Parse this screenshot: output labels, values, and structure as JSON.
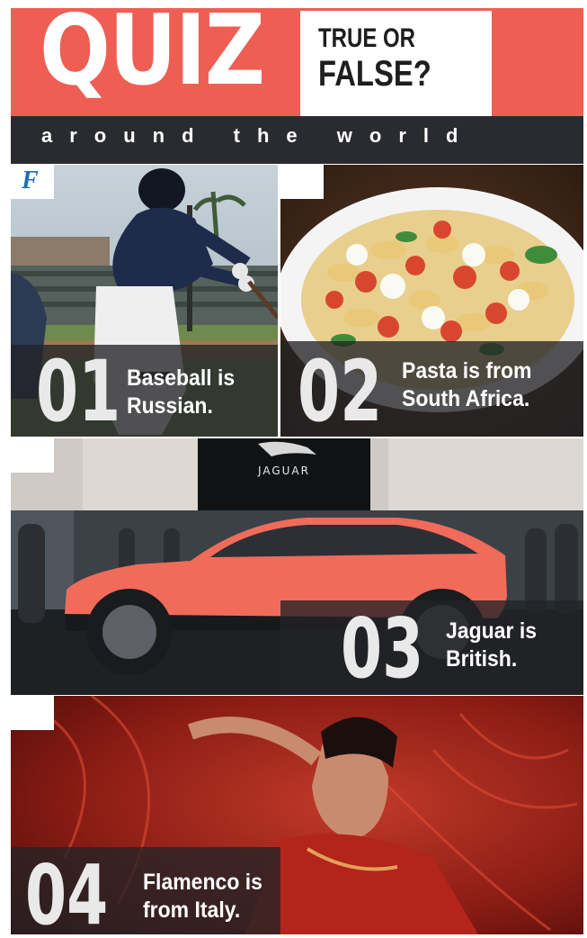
{
  "header": {
    "title": "QUIZ",
    "tf_line1": "TRUE OR",
    "tf_line2": "FALSE?",
    "subtitle": "around the world"
  },
  "quiz": [
    {
      "number": "01",
      "answer": "F",
      "statement_line1": "Baseball is",
      "statement_line2": "Russian."
    },
    {
      "number": "02",
      "answer": "",
      "statement_line1": "Pasta is from",
      "statement_line2": "South Africa."
    },
    {
      "number": "03",
      "answer": "",
      "statement_line1": "Jaguar is",
      "statement_line2": "British."
    },
    {
      "number": "04",
      "answer": "",
      "statement_line1": "Flamenco is",
      "statement_line2": "from Italy."
    }
  ],
  "brand_sign": "JAGUAR",
  "colors": {
    "accent": "#ef5e53",
    "dark_band": "#2a2b30",
    "answer_mark": "#1f6fb2"
  }
}
